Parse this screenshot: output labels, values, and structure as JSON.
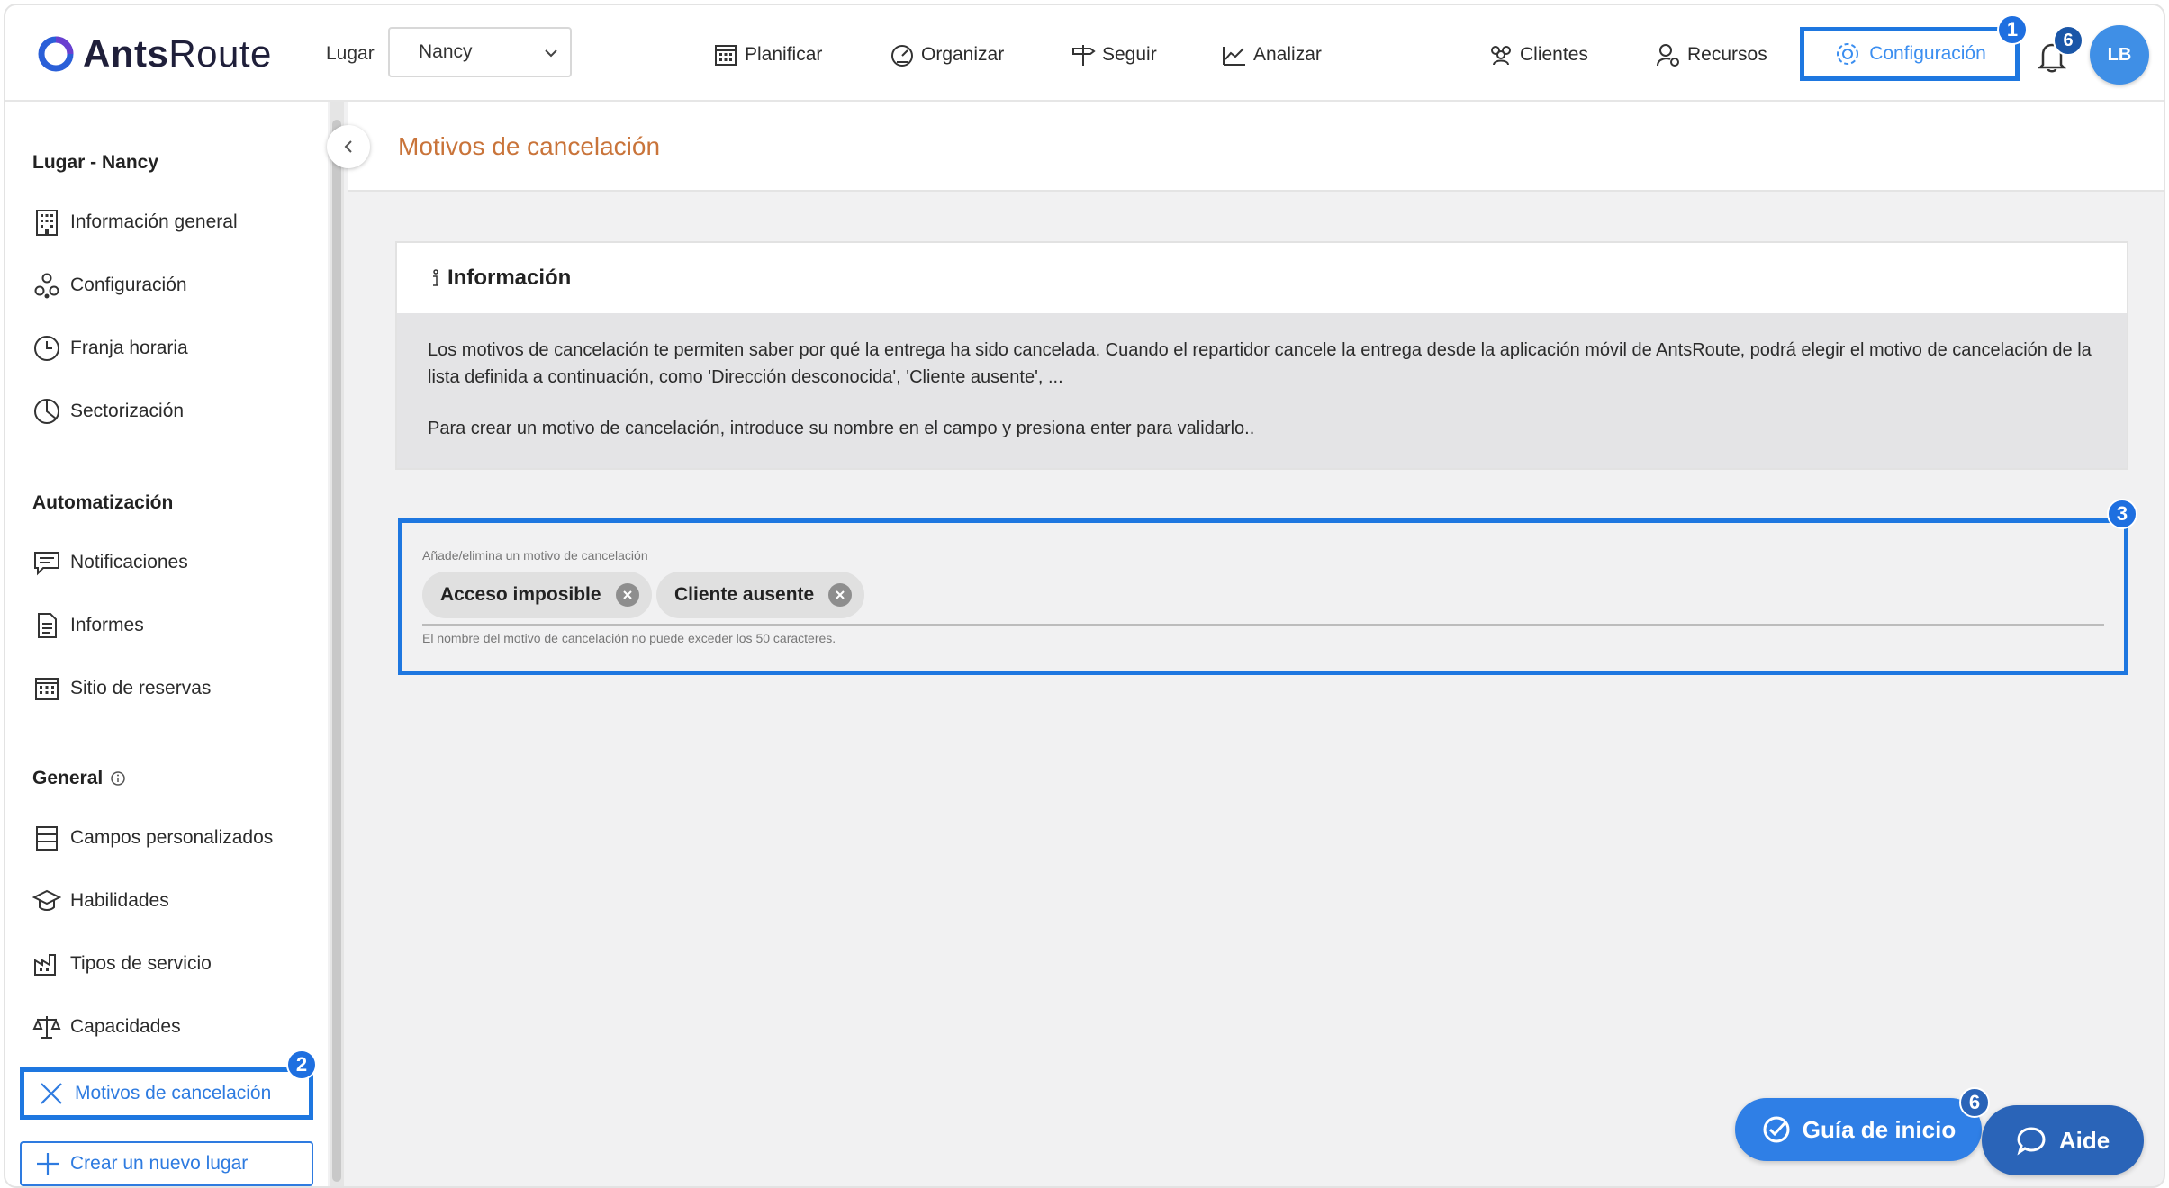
{
  "app": {
    "brand_bold": "Ants",
    "brand_regular": "Route"
  },
  "topbar": {
    "place_label": "Lugar",
    "place_value": "Nancy",
    "nav": [
      {
        "label": "Planificar",
        "icon": "calendar-icon"
      },
      {
        "label": "Organizar",
        "icon": "speedometer-icon"
      },
      {
        "label": "Seguir",
        "icon": "signpost-icon"
      },
      {
        "label": "Analizar",
        "icon": "chart-icon"
      },
      {
        "label": "Clientes",
        "icon": "users-icon"
      },
      {
        "label": "Recursos",
        "icon": "user-gear-icon"
      }
    ],
    "config_label": "Configuración",
    "config_step": "1",
    "notifications_count": "6",
    "avatar_initials": "LB",
    "accent": "#1e77e0"
  },
  "sidebar": {
    "section_place": "Lugar - Nancy",
    "place_items": [
      {
        "label": "Información general",
        "icon": "building-icon"
      },
      {
        "label": "Configuración",
        "icon": "nodes-icon"
      },
      {
        "label": "Franja horaria",
        "icon": "clock-icon"
      },
      {
        "label": "Sectorización",
        "icon": "pie-icon"
      }
    ],
    "section_automation": "Automatización",
    "automation_items": [
      {
        "label": "Notificaciones",
        "icon": "message-icon"
      },
      {
        "label": "Informes",
        "icon": "document-icon"
      },
      {
        "label": "Sitio de reservas",
        "icon": "calendar-grid-icon"
      }
    ],
    "section_general": "General",
    "general_items": [
      {
        "label": "Campos personalizados",
        "icon": "form-icon"
      },
      {
        "label": "Habilidades",
        "icon": "graduation-cap-icon"
      },
      {
        "label": "Tipos de servicio",
        "icon": "factory-icon"
      },
      {
        "label": "Capacidades",
        "icon": "scale-icon"
      }
    ],
    "active_item": "Motivos de cancelación",
    "active_step": "2",
    "new_place": "Crear un nuevo lugar"
  },
  "main": {
    "title": "Motivos de cancelación",
    "info_title": "Información",
    "info_p1": "Los motivos de cancelación te permiten saber por qué la entrega ha sido cancelada. Cuando el repartidor cancele la entrega desde la aplicación móvil de AntsRoute, podrá elegir el motivo de cancelación de la lista definida a continuación, como 'Dirección desconocida', 'Cliente ausente', ...",
    "info_p2": "Para crear un motivo de cancelación, introduce su nombre en el campo y presiona enter para validarlo..",
    "reasons_label": "Añade/elimina un motivo de cancelación",
    "reasons": [
      "Acceso imposible",
      "Cliente ausente"
    ],
    "reasons_hint": "El nombre del motivo de cancelación no puede exceder los 50 caracteres.",
    "reasons_step": "3"
  },
  "floating": {
    "guide_label": "Guía de inicio",
    "guide_count": "6",
    "aide_label": "Aide"
  }
}
